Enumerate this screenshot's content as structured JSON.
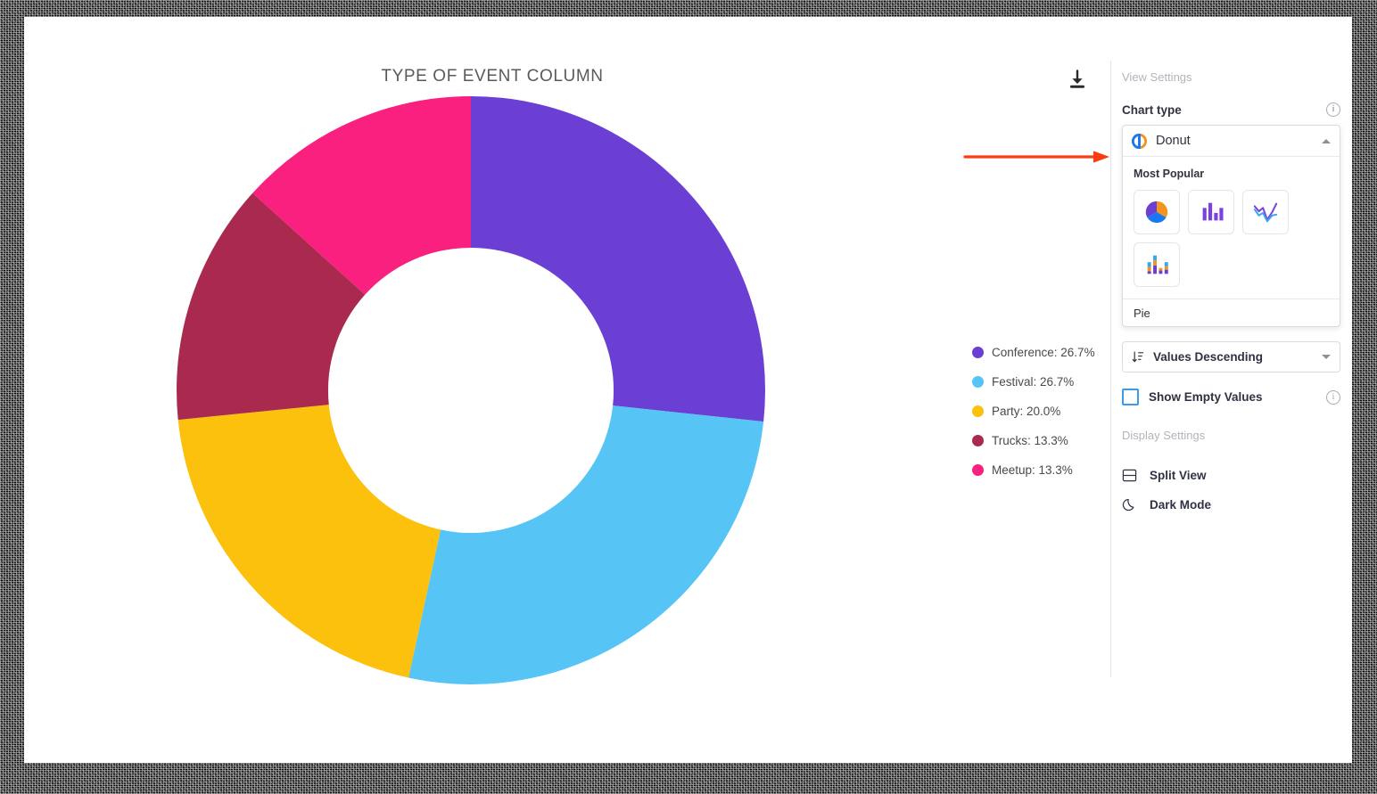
{
  "chart": {
    "title": "TYPE OF EVENT COLUMN",
    "download_icon": "download-icon"
  },
  "chart_data": {
    "type": "pie",
    "variant": "donut",
    "title": "TYPE OF EVENT COLUMN",
    "categories": [
      "Conference",
      "Festival",
      "Party",
      "Trucks",
      "Meetup"
    ],
    "values": [
      26.7,
      26.7,
      20.0,
      13.3,
      13.3
    ],
    "value_unit": "%",
    "colors": [
      "#6B3FD4",
      "#56C5F5",
      "#FBC10D",
      "#A92A4E",
      "#FA2080"
    ],
    "legend": [
      {
        "label": "Conference: 26.7%",
        "name": "Conference",
        "value": 26.7,
        "color": "#6B3FD4"
      },
      {
        "label": "Festival: 26.7%",
        "name": "Festival",
        "value": 26.7,
        "color": "#56C5F5"
      },
      {
        "label": "Party: 20.0%",
        "name": "Party",
        "value": 20.0,
        "color": "#FBC10D"
      },
      {
        "label": "Trucks: 13.3%",
        "name": "Trucks",
        "value": 13.3,
        "color": "#A92A4E"
      },
      {
        "label": "Meetup: 13.3%",
        "name": "Meetup",
        "value": 13.3,
        "color": "#FA2080"
      }
    ],
    "legend_position": "right",
    "grid": false,
    "start_angle_deg": 0,
    "direction": "clockwise",
    "inner_radius_ratio": 0.485
  },
  "panel": {
    "view_settings_title": "View Settings",
    "chart_type": {
      "label": "Chart type",
      "selected": "Donut",
      "group_title": "Most Popular",
      "options": [
        {
          "label": "Pie",
          "icon": "pie-chart-icon"
        },
        {
          "label": "Bar",
          "icon": "bar-chart-icon"
        },
        {
          "label": "Line",
          "icon": "line-chart-icon"
        },
        {
          "label": "Stacked Bar",
          "icon": "stacked-bar-chart-icon"
        }
      ],
      "next_group_label": "Pie"
    },
    "sort": {
      "selected": "Values Descending"
    },
    "show_empty_values": {
      "label": "Show Empty Values",
      "checked": false
    },
    "display_settings_title": "Display Settings",
    "display_options": [
      {
        "label": "Split View",
        "icon": "split-view-icon"
      },
      {
        "label": "Dark Mode",
        "icon": "moon-icon"
      }
    ]
  },
  "annotation": {
    "arrow_color": "#FA3E12"
  }
}
